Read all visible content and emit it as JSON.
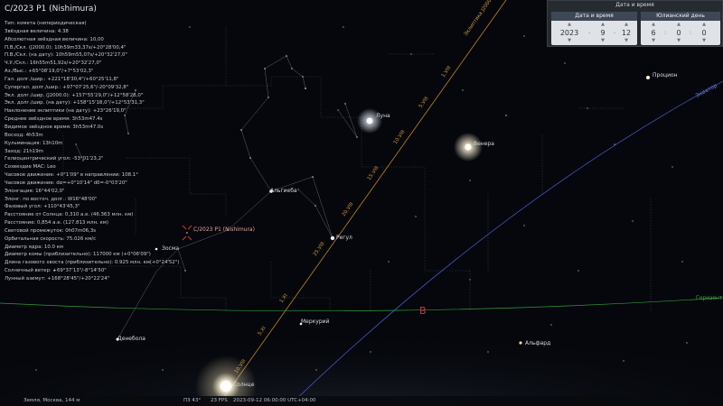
{
  "object": {
    "title": "C/2023 P1 (Nishimura)",
    "info_lines": [
      "Тип: комета (непериодическая)",
      "Звёздная величина: 4.38",
      "Абсолютная звёздная величина: 10,00",
      "П.В./Скл. (J2000.0): 10h59m33,37s/+20°28'00,4\"",
      "П.В./Скл. (на дату): 10h59m55,07s/+20°32'27,0\"",
      "Ч.У./Скл.: 16h55m51,92s/+20°32'27,0\"",
      "Аз./Выс.: +65°08'19,0\"/+7°53'02,3\"",
      "Гал. долг./шир.: +221°18'30,4\"/+60°25'11,8\"",
      "Супергал. долг./шир.: +97°07'25,6\"/-20°09'32,8\"",
      "Экл. долг./шир. (J2000.0): +157°55'29,0\"/+12°58'28,0\"",
      "Экл. долг./шир. (на дату): +158°15'18,0\"/+12°53'31,3\"",
      "Наклонение эклиптики (на дату): +23°26'19,0\"",
      "Среднее звёздное время: 3h53m47.4s",
      "Видимое звёздное время: 3h53m47.0s",
      "Восход: 4h53m",
      "Кульминация: 13h10m",
      "Заход: 21h19m",
      "Гелиоцентрический угол: -53°01'23,2\"",
      "Созвездие МАС: Leo",
      "Часовое движение: +0°1'09\" в направлении: 108.1°",
      "Часовое движение: dα=+0°10'14\" dδ=-0°03'20\"",
      "Элонгация: 16°44'02,0\"",
      "Элонг. по восточ. долг.: W16°48'00\"",
      "Фазовый угол: +110°43'45,3\"",
      "Расстояние от Солнца: 0,310 а.е. (46.363 млн. км)",
      "Расстояние: 0,854 а.е. (127.813 млн. км)",
      "Световой промежуток: 0h07m06,3s",
      "Орбитальная скорость: 75.026 км/с",
      "Диаметр ядра: 10.0 км",
      "Диаметр комы (приблизительно): 117000 км (+0°06'09\")",
      "Длина газового хвоста (приблизительно): 0.925 млн. км(+0°24'52\")",
      "Солнечный ветер: +69°37'13\"/-8°14'50\"",
      "Лунный азимут: +168°28'45\"/+20°22'24\""
    ]
  },
  "datetime_panel": {
    "title": "Дата и время",
    "date_tab": "Дата и время",
    "jd_tab": "Юлианский день",
    "year": "2023",
    "month": "9",
    "day": "12",
    "hour": "6",
    "minute": "0",
    "second": "0",
    "up_arrow": "▲",
    "down_arrow": "▼",
    "date_sep": "-",
    "time_sep": ":"
  },
  "sky": {
    "stars": [
      {
        "name": "Луна",
        "type": "moon"
      },
      {
        "name": "Венера",
        "type": "planet"
      },
      {
        "name": "Регул",
        "type": "star"
      },
      {
        "name": "Альгиеба",
        "type": "star"
      },
      {
        "name": "Зосма",
        "type": "star"
      },
      {
        "name": "Денебола",
        "type": "star"
      },
      {
        "name": "Процион",
        "type": "star"
      },
      {
        "name": "Альфард",
        "type": "star"
      },
      {
        "name": "Меркурий",
        "type": "planet"
      },
      {
        "name": "Солнце",
        "type": "sun"
      }
    ],
    "comet_label": "C/2023 P1 (Nishimura)",
    "ecliptic_label": "Эклиптика J2000",
    "equator_label": "Экватор",
    "horizon_label": "Горизонт",
    "cardinal_east": "В",
    "ecliptic_dates": [
      "10.VIII",
      "1.XI",
      "25.VIII",
      "20.VIII",
      "15.VIII",
      "10.VIII",
      "5.VIII",
      "1.VIII",
      "5.XI",
      "1.IX",
      "5.IX",
      "10.IX"
    ]
  },
  "status_bar": {
    "location": "Земля, Москва, 144 м",
    "fov": "ПЗ 43°",
    "fps": "23 FPS",
    "datetime": "2023-09-12 06:00:00 UTC+04:00"
  }
}
